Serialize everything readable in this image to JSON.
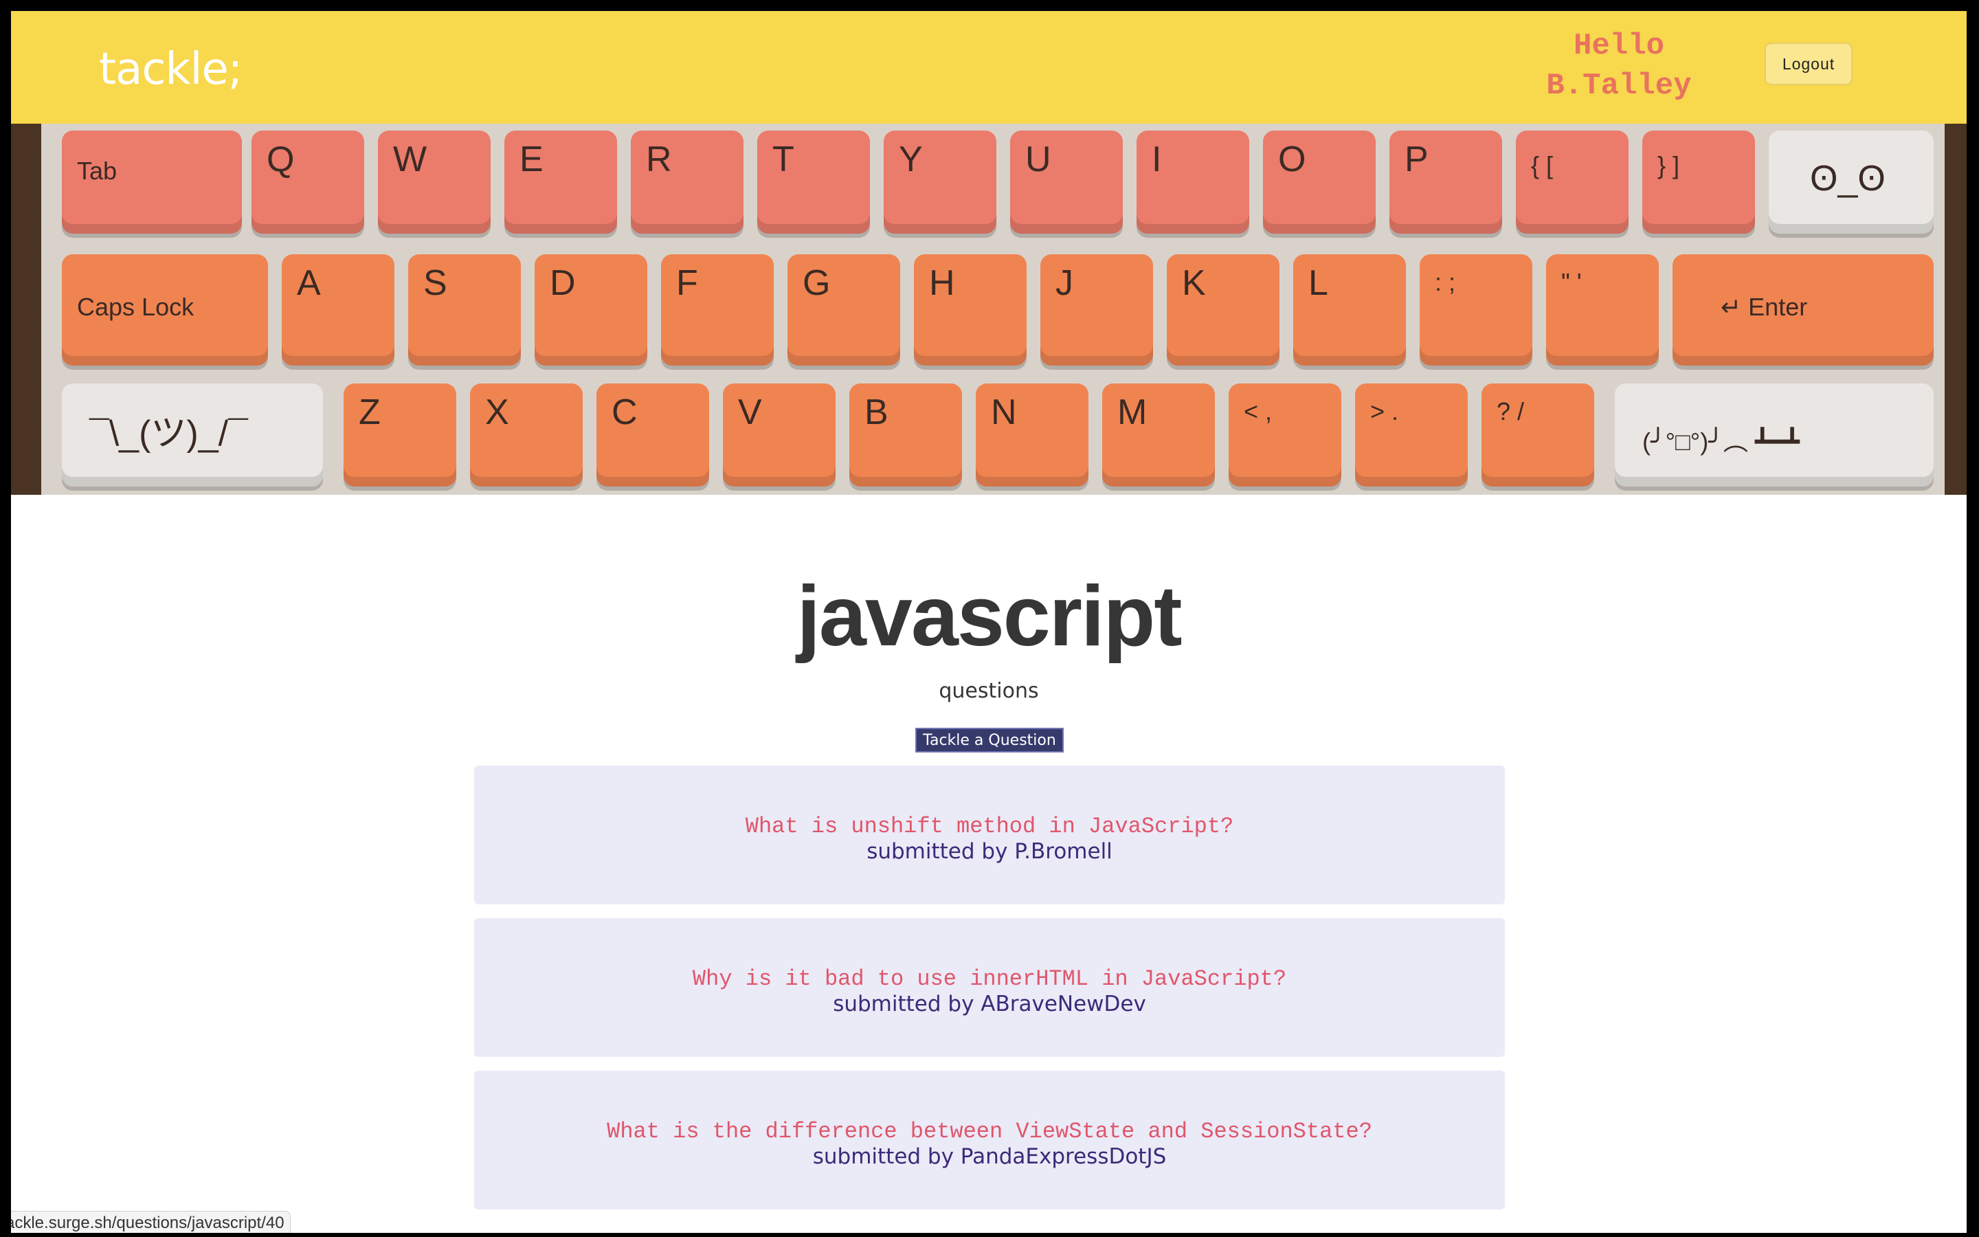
{
  "header": {
    "logo": "tackle;",
    "greeting_line1": "Hello",
    "greeting_line2": "B.Talley",
    "logout_label": "Logout",
    "background_color": "#f8d84c"
  },
  "hero": {
    "keys_row1": [
      "Tab",
      "Q",
      "W",
      "E",
      "R",
      "T",
      "Y",
      "U",
      "I",
      "O",
      "P",
      "{ [",
      "} ]",
      "ʘ_ʘ"
    ],
    "keys_row2": [
      "Caps Lock",
      "A",
      "S",
      "D",
      "F",
      "G",
      "H",
      "J",
      "K",
      "L",
      ": ;",
      "\" '",
      "↵ Enter"
    ],
    "keys_row3": [
      "¯\\_(ツ)_/¯",
      "Z",
      "X",
      "C",
      "V",
      "B",
      "N",
      "M",
      "< ,",
      "> .",
      "? /",
      "(╯°□°)╯︵ ┻━┻"
    ]
  },
  "main": {
    "title": "javascript",
    "subtitle": "questions",
    "tackle_button_label": "Tackle a Question",
    "questions": [
      {
        "text": "What is unshift method in JavaScript?",
        "author": "submitted by P.Bromell"
      },
      {
        "text": "Why is it bad to use innerHTML in JavaScript?",
        "author": "submitted by ABraveNewDev"
      },
      {
        "text": "What is the difference between ViewState and SessionState?",
        "author": "submitted by PandaExpressDotJS"
      }
    ]
  },
  "status_bar": {
    "url": "ackle.surge.sh/questions/javascript/40"
  }
}
